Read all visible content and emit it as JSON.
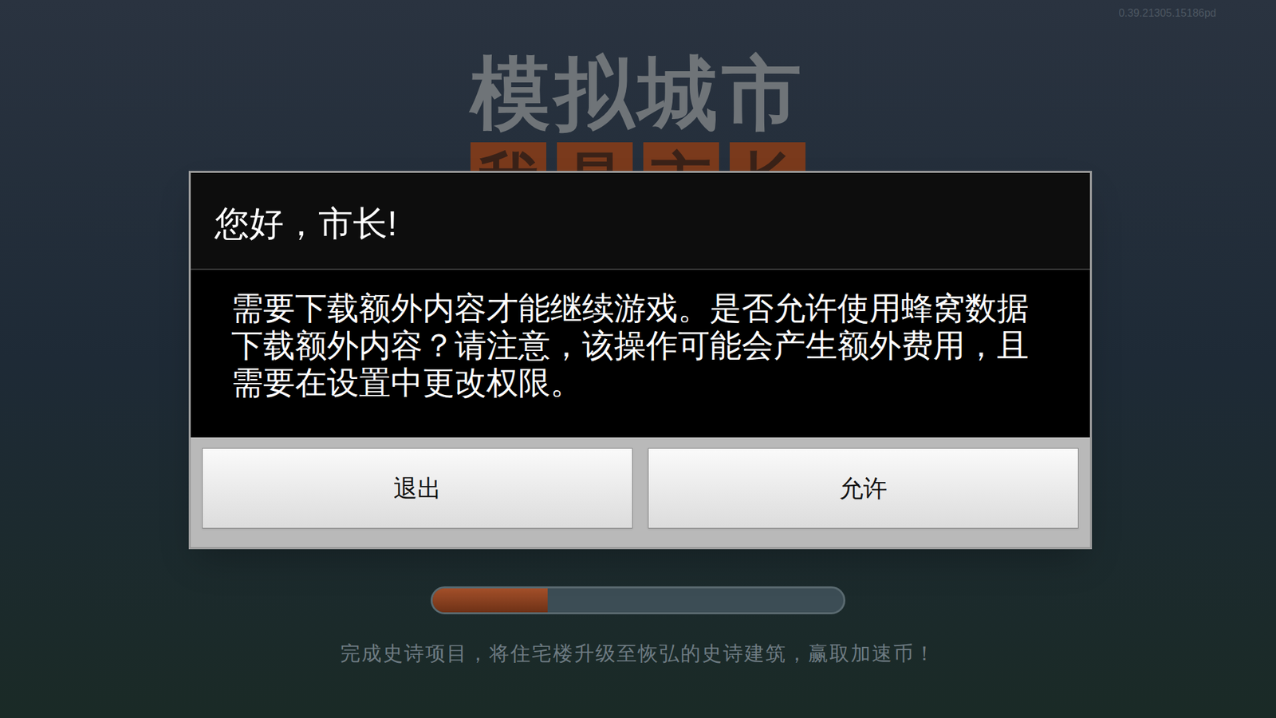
{
  "version": "0.39.21305.15186pd",
  "logo": {
    "title": "模拟城市",
    "subtitle": [
      "我",
      "是",
      "市",
      "长"
    ]
  },
  "dialog": {
    "title": "您好，市长!",
    "message": "需要下载额外内容才能继续游戏。是否允许使用蜂窝数据下载额外内容？请注意，该操作可能会产生额外费用，且需要在设置中更改权限。",
    "buttons": [
      "退出",
      "允许"
    ]
  },
  "loading": {
    "level": 0.28
  },
  "tip": "完成史诗项目，将住宅楼升级至恢弘的史诗建筑，赢取加速币！"
}
